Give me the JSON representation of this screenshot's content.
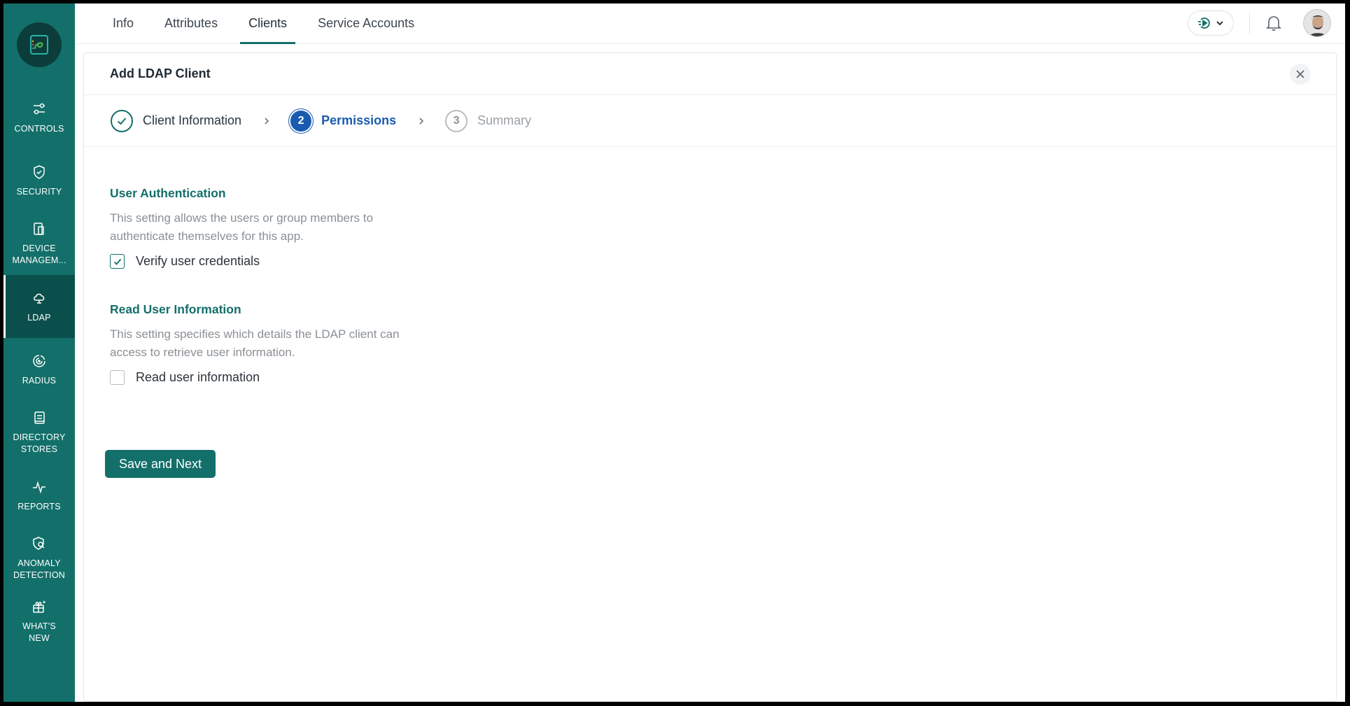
{
  "sidebar": {
    "logo_icon": "app-logo-icon",
    "items": [
      {
        "label": "CONTROLS",
        "icon": "sliders-icon"
      },
      {
        "label": "SECURITY",
        "icon": "shield-icon"
      },
      {
        "label": "DEVICE\nMANAGEM...",
        "icon": "device-icon"
      },
      {
        "label": "LDAP",
        "icon": "ldap-icon",
        "active": true
      },
      {
        "label": "RADIUS",
        "icon": "radius-icon"
      },
      {
        "label": "DIRECTORY\nSTORES",
        "icon": "directory-icon"
      },
      {
        "label": "REPORTS",
        "icon": "pulse-icon"
      },
      {
        "label": "ANOMALY\nDETECTION",
        "icon": "anomaly-shield-icon"
      },
      {
        "label": "WHAT'S\nNEW",
        "icon": "gift-icon"
      }
    ]
  },
  "tabs": [
    {
      "label": "Info"
    },
    {
      "label": "Attributes"
    },
    {
      "label": "Clients",
      "active": true
    },
    {
      "label": "Service Accounts"
    }
  ],
  "header_right": {
    "switcher_icon": "app-switcher-icon",
    "bell_icon": "bell-icon",
    "avatar_icon": "user-avatar"
  },
  "panel": {
    "title": "Add LDAP Client",
    "close_icon": "close-icon"
  },
  "stepper": {
    "steps": [
      {
        "number": "",
        "label": "Client Information",
        "state": "done"
      },
      {
        "number": "2",
        "label": "Permissions",
        "state": "current"
      },
      {
        "number": "3",
        "label": "Summary",
        "state": "todo"
      }
    ]
  },
  "sections": {
    "auth": {
      "title": "User Authentication",
      "description": "This setting allows the users or group members to authenticate themselves for this app.",
      "checkbox_label": "Verify user credentials",
      "checked": true
    },
    "read": {
      "title": "Read User Information",
      "description": "This setting specifies which details the LDAP client can access to retrieve user information.",
      "checkbox_label": "Read user information",
      "checked": false
    }
  },
  "actions": {
    "save_label": "Save and Next"
  },
  "colors": {
    "brand": "#136f6a",
    "accent_blue": "#1a5bb0",
    "sidebar_active": "#0b4f4c"
  }
}
